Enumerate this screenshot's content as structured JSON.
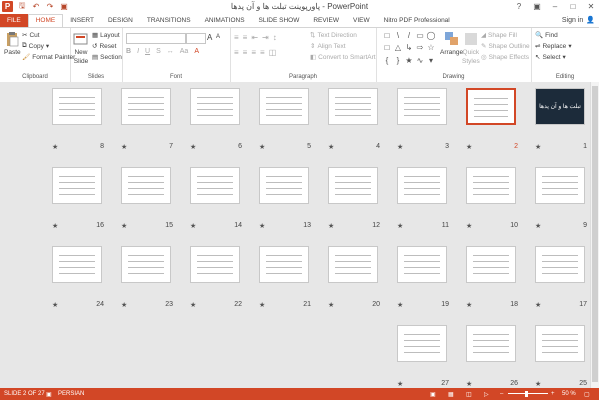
{
  "window": {
    "title": "پاورپوینت تبلت ها و آن پدها - PowerPoint"
  },
  "qat": [
    "P",
    "save",
    "undo",
    "redo",
    "start"
  ],
  "tabs": [
    "FILE",
    "HOME",
    "INSERT",
    "DESIGN",
    "TRANSITIONS",
    "ANIMATIONS",
    "SLIDE SHOW",
    "REVIEW",
    "VIEW",
    "Nitro PDF Professional"
  ],
  "account": {
    "signin": "Sign in"
  },
  "ribbon": {
    "clipboard": {
      "paste": "Paste",
      "cut": "Cut",
      "copy": "Copy",
      "format_painter": "Format Painter",
      "label": "Clipboard"
    },
    "slides": {
      "new_slide": "New",
      "new_slide2": "Slide",
      "layout": "Layout",
      "reset": "Reset",
      "section": "Section",
      "label": "Slides"
    },
    "font": {
      "label": "Font",
      "grow": "A",
      "shrink": "A"
    },
    "paragraph": {
      "text_direction": "Text Direction",
      "align_text": "Align Text",
      "convert": "Convert to SmartArt",
      "label": "Paragraph"
    },
    "drawing": {
      "arrange": "Arrange",
      "quick_styles": "Quick",
      "quick_styles2": "Styles",
      "shape_fill": "Shape Fill",
      "shape_outline": "Shape Outline",
      "shape_effects": "Shape Effects",
      "label": "Drawing"
    },
    "editing": {
      "find": "Find",
      "replace": "Replace",
      "select": "Select",
      "label": "Editing"
    }
  },
  "slides": [
    {
      "num": "1",
      "bg": "#1c2b3a",
      "text": "تبلت ها و آن پدها"
    },
    {
      "num": "2",
      "bg": "#ffffff",
      "text": ""
    },
    {
      "num": "3",
      "bg": "#ffffff",
      "text": ""
    },
    {
      "num": "4",
      "bg": "#ffffff",
      "text": ""
    },
    {
      "num": "5",
      "bg": "#ffffff",
      "text": ""
    },
    {
      "num": "6",
      "bg": "#ffffff",
      "text": ""
    },
    {
      "num": "7",
      "bg": "#ffffff",
      "text": ""
    },
    {
      "num": "8",
      "bg": "#ffffff",
      "text": ""
    },
    {
      "num": "9",
      "bg": "#ffffff",
      "text": ""
    },
    {
      "num": "10",
      "bg": "#ffffff",
      "text": ""
    },
    {
      "num": "11",
      "bg": "#ffffff",
      "text": ""
    },
    {
      "num": "12",
      "bg": "#ffffff",
      "text": ""
    },
    {
      "num": "13",
      "bg": "#ffffff",
      "text": ""
    },
    {
      "num": "14",
      "bg": "#ffffff",
      "text": ""
    },
    {
      "num": "15",
      "bg": "#ffffff",
      "text": ""
    },
    {
      "num": "16",
      "bg": "#ffffff",
      "text": ""
    },
    {
      "num": "17",
      "bg": "#ffffff",
      "text": ""
    },
    {
      "num": "18",
      "bg": "#ffffff",
      "text": ""
    },
    {
      "num": "19",
      "bg": "#ffffff",
      "text": ""
    },
    {
      "num": "20",
      "bg": "#ffffff",
      "text": ""
    },
    {
      "num": "21",
      "bg": "#ffffff",
      "text": ""
    },
    {
      "num": "22",
      "bg": "#ffffff",
      "text": ""
    },
    {
      "num": "23",
      "bg": "#ffffff",
      "text": ""
    },
    {
      "num": "24",
      "bg": "#ffffff",
      "text": ""
    },
    {
      "num": "25",
      "bg": "#ffffff",
      "text": ""
    },
    {
      "num": "26",
      "bg": "#ffffff",
      "text": ""
    },
    {
      "num": "27",
      "bg": "#ffffff",
      "text": ""
    }
  ],
  "selected_slide": "2",
  "status": {
    "slide_info": "SLIDE 2 OF 27",
    "language": "PERSIAN",
    "zoom": "50 %"
  },
  "colors": {
    "accent": "#d24726",
    "ribbon_bg": "#ffffff",
    "workspace": "#e7e7e7"
  }
}
